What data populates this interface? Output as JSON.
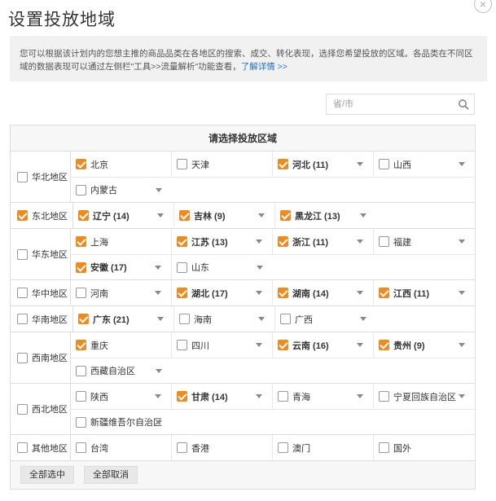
{
  "dialog": {
    "title": "设置投放地域",
    "close_glyph": "×",
    "description": "您可以根据该计划内的您想主推的商品品类在各地区的搜索、成交、转化表现，选择您希望投放的区域。各品类在不同区域的数据表现可以通过左侧栏\"工具>>流量解析\"功能查看，",
    "learn_more": "了解详情 >>"
  },
  "search": {
    "placeholder": "省/市"
  },
  "table": {
    "header": "请选择投放区域"
  },
  "regions": [
    {
      "name": "华北地区",
      "checked": false,
      "lines": [
        [
          {
            "label": "北京",
            "checked": true,
            "dropdown": false
          },
          {
            "label": "天津",
            "checked": false,
            "dropdown": false
          },
          {
            "label": "河北 (11)",
            "checked": true,
            "dropdown": true,
            "bold": true
          },
          {
            "label": "山西",
            "checked": false,
            "dropdown": true
          }
        ],
        [
          {
            "label": "内蒙古",
            "checked": false,
            "dropdown": true
          }
        ]
      ]
    },
    {
      "name": "东北地区",
      "checked": true,
      "lines": [
        [
          {
            "label": "辽宁 (14)",
            "checked": true,
            "dropdown": true,
            "bold": true
          },
          {
            "label": "吉林 (9)",
            "checked": true,
            "dropdown": true,
            "bold": true
          },
          {
            "label": "黑龙江 (13)",
            "checked": true,
            "dropdown": true,
            "bold": true
          }
        ]
      ]
    },
    {
      "name": "华东地区",
      "checked": false,
      "lines": [
        [
          {
            "label": "上海",
            "checked": true,
            "dropdown": false
          },
          {
            "label": "江苏 (13)",
            "checked": true,
            "dropdown": true,
            "bold": true
          },
          {
            "label": "浙江 (11)",
            "checked": true,
            "dropdown": true,
            "bold": true
          },
          {
            "label": "福建",
            "checked": false,
            "dropdown": true
          }
        ],
        [
          {
            "label": "安徽 (17)",
            "checked": true,
            "dropdown": true,
            "bold": true
          },
          {
            "label": "山东",
            "checked": false,
            "dropdown": true
          }
        ]
      ]
    },
    {
      "name": "华中地区",
      "checked": false,
      "lines": [
        [
          {
            "label": "河南",
            "checked": false,
            "dropdown": true
          },
          {
            "label": "湖北 (17)",
            "checked": true,
            "dropdown": true,
            "bold": true
          },
          {
            "label": "湖南 (14)",
            "checked": true,
            "dropdown": true,
            "bold": true
          },
          {
            "label": "江西 (11)",
            "checked": true,
            "dropdown": true,
            "bold": true
          }
        ]
      ]
    },
    {
      "name": "华南地区",
      "checked": false,
      "lines": [
        [
          {
            "label": "广东 (21)",
            "checked": true,
            "dropdown": true,
            "bold": true
          },
          {
            "label": "海南",
            "checked": false,
            "dropdown": true
          },
          {
            "label": "广西",
            "checked": false,
            "dropdown": true
          }
        ]
      ]
    },
    {
      "name": "西南地区",
      "checked": false,
      "lines": [
        [
          {
            "label": "重庆",
            "checked": true,
            "dropdown": false
          },
          {
            "label": "四川",
            "checked": false,
            "dropdown": true
          },
          {
            "label": "云南 (16)",
            "checked": true,
            "dropdown": true,
            "bold": true
          },
          {
            "label": "贵州 (9)",
            "checked": true,
            "dropdown": true,
            "bold": true
          }
        ],
        [
          {
            "label": "西藏自治区",
            "checked": false,
            "dropdown": true
          }
        ]
      ]
    },
    {
      "name": "西北地区",
      "checked": false,
      "lines": [
        [
          {
            "label": "陕西",
            "checked": false,
            "dropdown": true
          },
          {
            "label": "甘肃 (14)",
            "checked": true,
            "dropdown": true,
            "bold": true
          },
          {
            "label": "青海",
            "checked": false,
            "dropdown": true
          },
          {
            "label": "宁夏回族自治区",
            "checked": false,
            "dropdown": true
          }
        ],
        [
          {
            "label": "新疆维吾尔自治区",
            "checked": false,
            "dropdown": true
          }
        ]
      ]
    },
    {
      "name": "其他地区",
      "checked": false,
      "lines": [
        [
          {
            "label": "台湾",
            "checked": false,
            "dropdown": false
          },
          {
            "label": "香港",
            "checked": false,
            "dropdown": false
          },
          {
            "label": "澳门",
            "checked": false,
            "dropdown": false
          },
          {
            "label": "国外",
            "checked": false,
            "dropdown": false
          }
        ]
      ]
    }
  ],
  "footer": {
    "select_all": "全部选中",
    "deselect_all": "全部取消"
  },
  "colors": {
    "accent": "#f08a1c",
    "link": "#1f6fd1"
  }
}
